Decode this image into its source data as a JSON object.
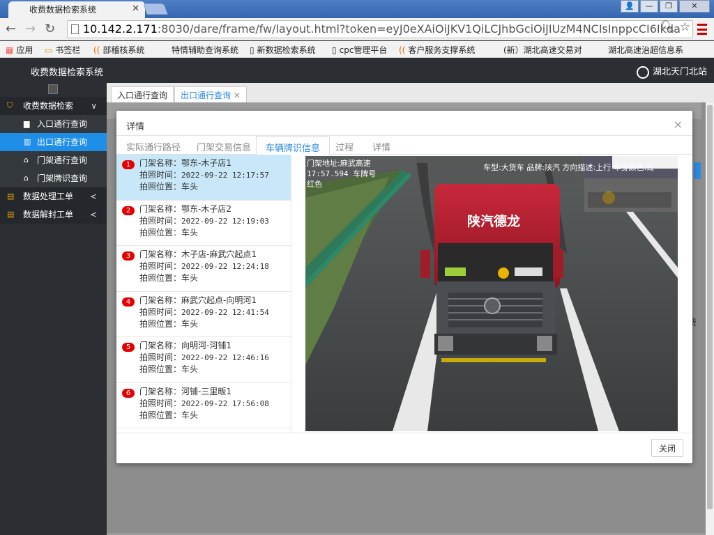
{
  "browser": {
    "tab_title": "收费数据检索系统",
    "url_host": "10.142.2.171",
    "url_rest": ":8030/dare/frame/fw/layout.html?token=eyJ0eXAiOiJKV1QiLCJhbGciOiJIUzM4NCIsInppcCI6Ikda",
    "bookmarks": [
      "应用",
      "书签栏",
      "部稽核系统",
      "特情辅助查询系统",
      "新数据检索系统",
      "cpc管理平台",
      "客户服务支撑系统",
      "(新）湖北高速交易对",
      "湖北高速治超信息系"
    ]
  },
  "header": {
    "title": "收费数据检索系统",
    "user": "湖北天门北站"
  },
  "sidebar": {
    "items": [
      {
        "label": "收费数据检索",
        "icon": "shield-icon",
        "type": "group",
        "arrow": "∨"
      },
      {
        "label": "入口通行查询",
        "icon": "car-icon",
        "type": "sub"
      },
      {
        "label": "出口通行查询",
        "icon": "chart-icon",
        "type": "sub",
        "active": true
      },
      {
        "label": "门架通行查询",
        "icon": "home-icon",
        "type": "sub"
      },
      {
        "label": "门架牌识查询",
        "icon": "home-icon",
        "type": "sub"
      },
      {
        "label": "数据处理工单",
        "icon": "file-icon",
        "type": "group",
        "arrow": "<"
      },
      {
        "label": "数据解封工单",
        "icon": "list-icon",
        "type": "group",
        "arrow": "<"
      }
    ]
  },
  "page_tabs": [
    {
      "label": "入口通行查询"
    },
    {
      "label": "出口通行查询"
    }
  ],
  "background": {
    "partial_text": "费"
  },
  "modal": {
    "title": "详情",
    "tabs": [
      "实际通行路径",
      "门架交易信息",
      "车辆牌识信息",
      "过程",
      "详情"
    ],
    "active_tab": "车辆牌识信息",
    "labels": {
      "gantry": "门架名称：",
      "time": "拍照时间：",
      "pos": "拍照位置："
    },
    "records": [
      {
        "no": "1",
        "gantry": "鄂东-木子店1",
        "time": "2022-09-22 12:17:57",
        "pos": "车头"
      },
      {
        "no": "2",
        "gantry": "鄂东-木子店2",
        "time": "2022-09-22 12:19:03",
        "pos": "车头"
      },
      {
        "no": "3",
        "gantry": "木子店-麻武穴起点1",
        "time": "2022-09-22 12:24:18",
        "pos": "车头"
      },
      {
        "no": "4",
        "gantry": "麻武穴起点-向明河1",
        "time": "2022-09-22 12:41:54",
        "pos": "车头"
      },
      {
        "no": "5",
        "gantry": "向明河-河铺1",
        "time": "2022-09-22 12:46:16",
        "pos": "车头"
      },
      {
        "no": "6",
        "gantry": "河铺-三里畈1",
        "time": "2022-09-22 17:56:08",
        "pos": "车头"
      }
    ],
    "photo": {
      "overlay_line1": "门架地址:麻武高速",
      "overlay_line2": "17:57.594 车牌号",
      "overlay_line3": "红色",
      "overlay_right": "车型:大货车  品牌:陕汽  方向描述:上行  车身颜色:红",
      "truck_brand": "陕汽德龙"
    },
    "close_label": "关闭"
  }
}
